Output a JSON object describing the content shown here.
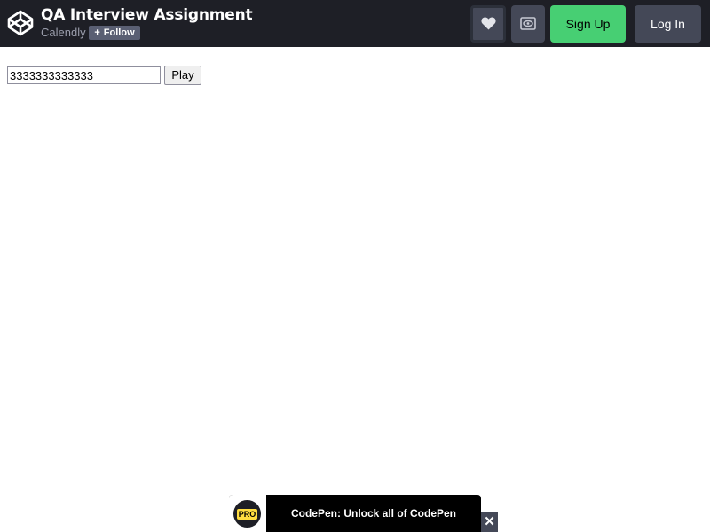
{
  "header": {
    "title": "QA Interview Assignment",
    "author": "Calendly",
    "follow_label": "Follow",
    "follow_icon": "plus-icon",
    "heart_icon": "heart-icon",
    "view_icon": "eye-icon",
    "signup_label": "Sign Up",
    "login_label": "Log In",
    "logo_icon": "codepen-logo-icon"
  },
  "main": {
    "input_value": "3333333333333",
    "play_label": "Play"
  },
  "banner": {
    "badge_label": "PRO",
    "text": "CodePen: Unlock all of CodePen",
    "close_label": "✕"
  },
  "colors": {
    "header_bg": "#1e1f26",
    "signup_bg": "#47cf73",
    "button_bg": "#444857",
    "pro_yellow": "#ffdd40"
  }
}
